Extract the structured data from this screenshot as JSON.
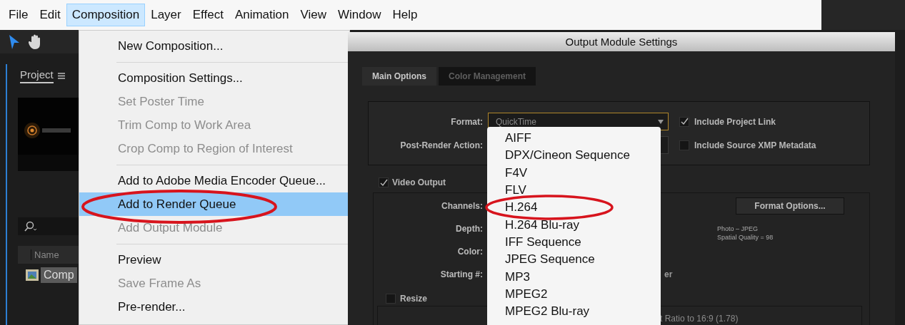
{
  "menu_bar": {
    "items": [
      {
        "label": "File",
        "selected": false
      },
      {
        "label": "Edit",
        "selected": false
      },
      {
        "label": "Composition",
        "selected": true
      },
      {
        "label": "Layer",
        "selected": false
      },
      {
        "label": "Effect",
        "selected": false
      },
      {
        "label": "Animation",
        "selected": false
      },
      {
        "label": "View",
        "selected": false
      },
      {
        "label": "Window",
        "selected": false
      },
      {
        "label": "Help",
        "selected": false
      }
    ]
  },
  "project_panel": {
    "tab": "Project",
    "preview": {
      "kind": "picture"
    },
    "columns": [
      "Name"
    ],
    "items": [
      {
        "name": "Comp",
        "selected": true
      }
    ]
  },
  "composition_menu": {
    "items": [
      {
        "kind": "item",
        "label": "New Composition...",
        "disabled": false,
        "selected": false
      },
      {
        "kind": "separator"
      },
      {
        "kind": "item",
        "label": "Composition Settings...",
        "disabled": false,
        "selected": false
      },
      {
        "kind": "item",
        "label": "Set Poster Time",
        "disabled": true,
        "selected": false
      },
      {
        "kind": "item",
        "label": "Trim Comp to Work Area",
        "disabled": true,
        "selected": false
      },
      {
        "kind": "item",
        "label": "Crop Comp to Region of Interest",
        "disabled": true,
        "selected": false
      },
      {
        "kind": "separator"
      },
      {
        "kind": "item",
        "label": "Add to Adobe Media Encoder Queue...",
        "disabled": false,
        "selected": false
      },
      {
        "kind": "item",
        "label": "Add to Render Queue",
        "disabled": false,
        "selected": true
      },
      {
        "kind": "item",
        "label": "Add Output Module",
        "disabled": true,
        "selected": false
      },
      {
        "kind": "separator"
      },
      {
        "kind": "item",
        "label": "Preview",
        "disabled": false,
        "selected": false
      },
      {
        "kind": "item",
        "label": "Save Frame As",
        "disabled": true,
        "selected": false
      },
      {
        "kind": "item",
        "label": "Pre-render...",
        "disabled": false,
        "selected": false
      }
    ]
  },
  "dialog": {
    "title": "Output Module Settings",
    "tabs": [
      {
        "label": "Main Options",
        "selected": true
      },
      {
        "label": "Color Management",
        "selected": false
      }
    ],
    "format": {
      "label": "Format:",
      "value": "QuickTime",
      "options": [
        {
          "label": "AIFF"
        },
        {
          "label": "DPX/Cineon Sequence"
        },
        {
          "label": "F4V"
        },
        {
          "label": "FLV"
        },
        {
          "label": "H.264"
        },
        {
          "label": "H.264 Blu-ray"
        },
        {
          "label": "IFF Sequence"
        },
        {
          "label": "JPEG Sequence"
        },
        {
          "label": "MP3"
        },
        {
          "label": "MPEG2"
        },
        {
          "label": "MPEG2 Blu-ray"
        }
      ]
    },
    "post_render_action": {
      "label": "Post-Render Action:"
    },
    "options": [
      {
        "label": "Include Project Link",
        "checked": true
      },
      {
        "label": "Include Source XMP Metadata",
        "checked": false
      }
    ],
    "video_output": {
      "label": "Video Output",
      "checked": true,
      "fields": [
        {
          "label": "Channels:"
        },
        {
          "label": "Depth:"
        },
        {
          "label": "Color:"
        },
        {
          "label": "Starting #:",
          "fragment": "er"
        }
      ],
      "format_options_button": "Format Options...",
      "format_info": [
        "Photo – JPEG",
        "Spatial Quality = 98"
      ],
      "resize": {
        "label": "Resize",
        "checked": false,
        "fragment": "t Ratio to 16:9 (1.78)"
      }
    }
  }
}
